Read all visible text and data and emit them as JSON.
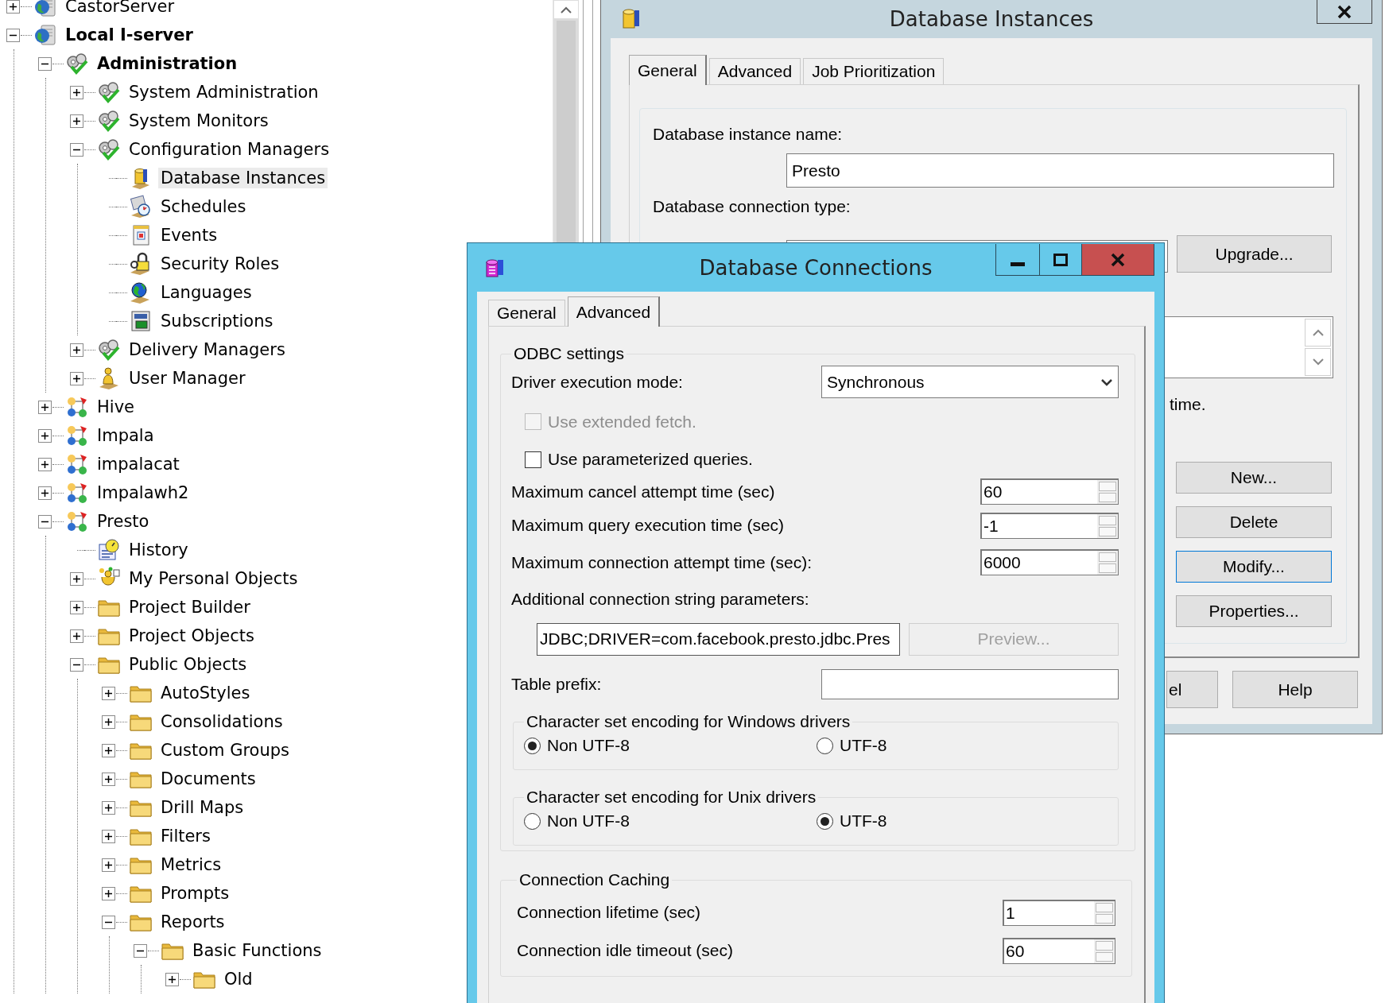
{
  "tree": {
    "nodes": [
      {
        "label": "CastorServer",
        "kind": "server",
        "expanded": false,
        "selected": false
      },
      {
        "label": "Local I-server",
        "kind": "server",
        "expanded": true,
        "selected": false,
        "bold": true,
        "children": [
          {
            "label": "Administration",
            "kind": "gears",
            "expanded": true,
            "selected": false,
            "bold": true,
            "children": [
              {
                "label": "System Administration",
                "kind": "gears",
                "expanded": false,
                "selected": false
              },
              {
                "label": "System Monitors",
                "kind": "gears",
                "expanded": false,
                "selected": false
              },
              {
                "label": "Configuration Managers",
                "kind": "gears",
                "expanded": true,
                "selected": false,
                "children": [
                  {
                    "label": "Database Instances",
                    "kind": "database",
                    "selected": true
                  },
                  {
                    "label": "Schedules",
                    "kind": "schedule",
                    "selected": false
                  },
                  {
                    "label": "Events",
                    "kind": "event",
                    "selected": false
                  },
                  {
                    "label": "Security Roles",
                    "kind": "security",
                    "selected": false
                  },
                  {
                    "label": "Languages",
                    "kind": "language",
                    "selected": false
                  },
                  {
                    "label": "Subscriptions",
                    "kind": "subscription",
                    "selected": false
                  }
                ]
              },
              {
                "label": "Delivery Managers",
                "kind": "gears",
                "expanded": false,
                "selected": false
              },
              {
                "label": "User Manager",
                "kind": "user",
                "expanded": false,
                "selected": false
              }
            ]
          },
          {
            "label": "Hive",
            "kind": "project",
            "expanded": false,
            "selected": false
          },
          {
            "label": "Impala",
            "kind": "project",
            "expanded": false,
            "selected": false
          },
          {
            "label": "impalacat",
            "kind": "project",
            "expanded": false,
            "selected": false
          },
          {
            "label": "Impalawh2",
            "kind": "project",
            "expanded": false,
            "selected": false
          },
          {
            "label": "Presto",
            "kind": "project",
            "expanded": true,
            "selected": false,
            "children": [
              {
                "label": "History",
                "kind": "history",
                "selected": false
              },
              {
                "label": "My Personal Objects",
                "kind": "personal",
                "expanded": false,
                "selected": false
              },
              {
                "label": "Project Builder",
                "kind": "folder",
                "expanded": false,
                "selected": false
              },
              {
                "label": "Project Objects",
                "kind": "folder",
                "expanded": false,
                "selected": false
              },
              {
                "label": "Public Objects",
                "kind": "folder",
                "expanded": true,
                "selected": false,
                "children": [
                  {
                    "label": "AutoStyles",
                    "kind": "folder",
                    "expanded": false,
                    "selected": false
                  },
                  {
                    "label": "Consolidations",
                    "kind": "folder",
                    "expanded": false,
                    "selected": false
                  },
                  {
                    "label": "Custom Groups",
                    "kind": "folder",
                    "expanded": false,
                    "selected": false
                  },
                  {
                    "label": "Documents",
                    "kind": "folder",
                    "expanded": false,
                    "selected": false
                  },
                  {
                    "label": "Drill Maps",
                    "kind": "folder",
                    "expanded": false,
                    "selected": false
                  },
                  {
                    "label": "Filters",
                    "kind": "folder",
                    "expanded": false,
                    "selected": false
                  },
                  {
                    "label": "Metrics",
                    "kind": "folder",
                    "expanded": false,
                    "selected": false
                  },
                  {
                    "label": "Prompts",
                    "kind": "folder",
                    "expanded": false,
                    "selected": false
                  },
                  {
                    "label": "Reports",
                    "kind": "folder",
                    "expanded": true,
                    "selected": false,
                    "children": [
                      {
                        "label": "Basic Functions",
                        "kind": "folder",
                        "expanded": true,
                        "selected": false,
                        "children": [
                          {
                            "label": "Old",
                            "kind": "folder",
                            "expanded": false,
                            "selected": false
                          }
                        ]
                      }
                    ]
                  }
                ]
              }
            ]
          }
        ]
      }
    ]
  },
  "instances_window": {
    "title": "Database Instances",
    "tabs": [
      {
        "label": "General",
        "selected": true
      },
      {
        "label": "Advanced",
        "selected": false
      },
      {
        "label": "Job Prioritization",
        "selected": false
      }
    ],
    "instance_name_label": "Database instance name:",
    "instance_name": "Presto",
    "connection_type_label": "Database connection type:",
    "upgrade_button": "Upgrade...",
    "note_fragment": "time.",
    "buttons": [
      {
        "label": "New...",
        "focused": false
      },
      {
        "label": "Delete",
        "focused": false
      },
      {
        "label": "Modify...",
        "focused": true
      },
      {
        "label": "Properties...",
        "focused": false
      }
    ],
    "footer_buttons": [
      "el",
      "Help"
    ]
  },
  "connections_window": {
    "title": "Database Connections",
    "tabs": [
      {
        "label": "General",
        "selected": false
      },
      {
        "label": "Advanced",
        "selected": true
      }
    ],
    "odbc": {
      "legend": "ODBC settings",
      "driver_mode_label": "Driver execution mode:",
      "driver_mode": "Synchronous",
      "checkboxes": [
        {
          "label": "Use extended fetch.",
          "checked": false,
          "disabled": true
        },
        {
          "label": "Use parameterized queries.",
          "checked": false,
          "disabled": false
        }
      ],
      "spins": [
        {
          "label": "Maximum cancel attempt time (sec)",
          "value": "60"
        },
        {
          "label": "Maximum query execution time (sec)",
          "value": "-1"
        },
        {
          "label": "Maximum connection attempt time (sec):",
          "value": "6000"
        }
      ],
      "additional_label": "Additional connection string parameters:",
      "connection_string": "JDBC;DRIVER=com.facebook.presto.jdbc.Pres",
      "preview_button": {
        "label": "Preview...",
        "disabled": true
      },
      "table_prefix_label": "Table prefix:",
      "encodings": [
        {
          "legend": "Character set encoding for Windows drivers",
          "options": [
            {
              "label": "Non UTF-8",
              "selected": true
            },
            {
              "label": "UTF-8",
              "selected": false
            }
          ]
        },
        {
          "legend": "Character set encoding for Unix drivers",
          "options": [
            {
              "label": "Non UTF-8",
              "selected": false
            },
            {
              "label": "UTF-8",
              "selected": true
            }
          ]
        }
      ]
    },
    "caching": {
      "legend": "Connection Caching",
      "spins": [
        {
          "label": "Connection lifetime (sec)",
          "value": "1"
        },
        {
          "label": "Connection idle timeout (sec)",
          "value": "60"
        }
      ]
    }
  }
}
